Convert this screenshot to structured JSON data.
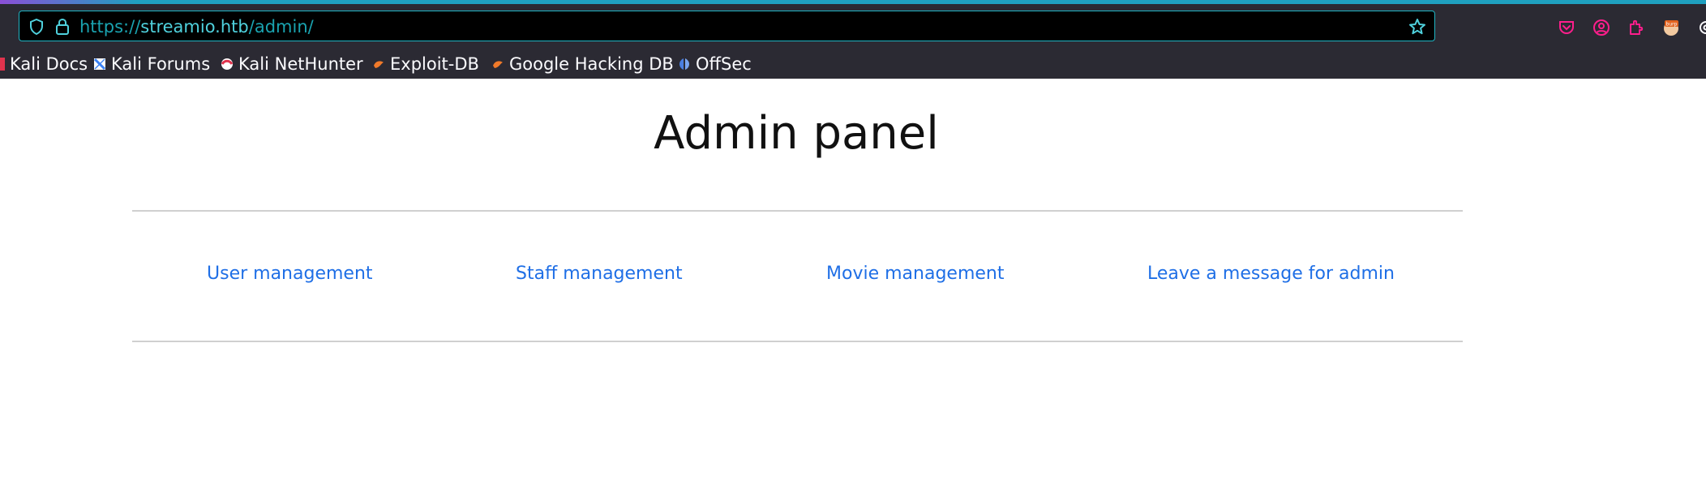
{
  "browser": {
    "url": {
      "scheme": "https://",
      "host": "streamio.htb",
      "path": "/admin/"
    },
    "toolbar_icons": [
      "pocket-icon",
      "account-icon",
      "extensions-icon",
      "burp-icon",
      "settings-icon"
    ],
    "bookmarks": [
      {
        "label": "Kali Docs",
        "icon": "kali-docs-icon",
        "color": "#e0334d"
      },
      {
        "label": "Kali Forums",
        "icon": "kali-forums-icon",
        "color": "#3b82f6"
      },
      {
        "label": "Kali NetHunter",
        "icon": "kali-nethunter-icon",
        "color": "#e0334d"
      },
      {
        "label": "Exploit-DB",
        "icon": "exploit-db-icon",
        "color": "#f07a2a"
      },
      {
        "label": "Google Hacking DB",
        "icon": "ghdb-icon",
        "color": "#f07a2a"
      },
      {
        "label": "OffSec",
        "icon": "offsec-icon",
        "color": "#4a7fe0"
      }
    ],
    "accent_color": "#1fb5c4"
  },
  "page": {
    "title": "Admin panel",
    "links": [
      {
        "label": "User management"
      },
      {
        "label": "Staff management"
      },
      {
        "label": "Movie management"
      },
      {
        "label": "Leave a message for admin"
      }
    ],
    "link_color": "#1f6fe6"
  }
}
